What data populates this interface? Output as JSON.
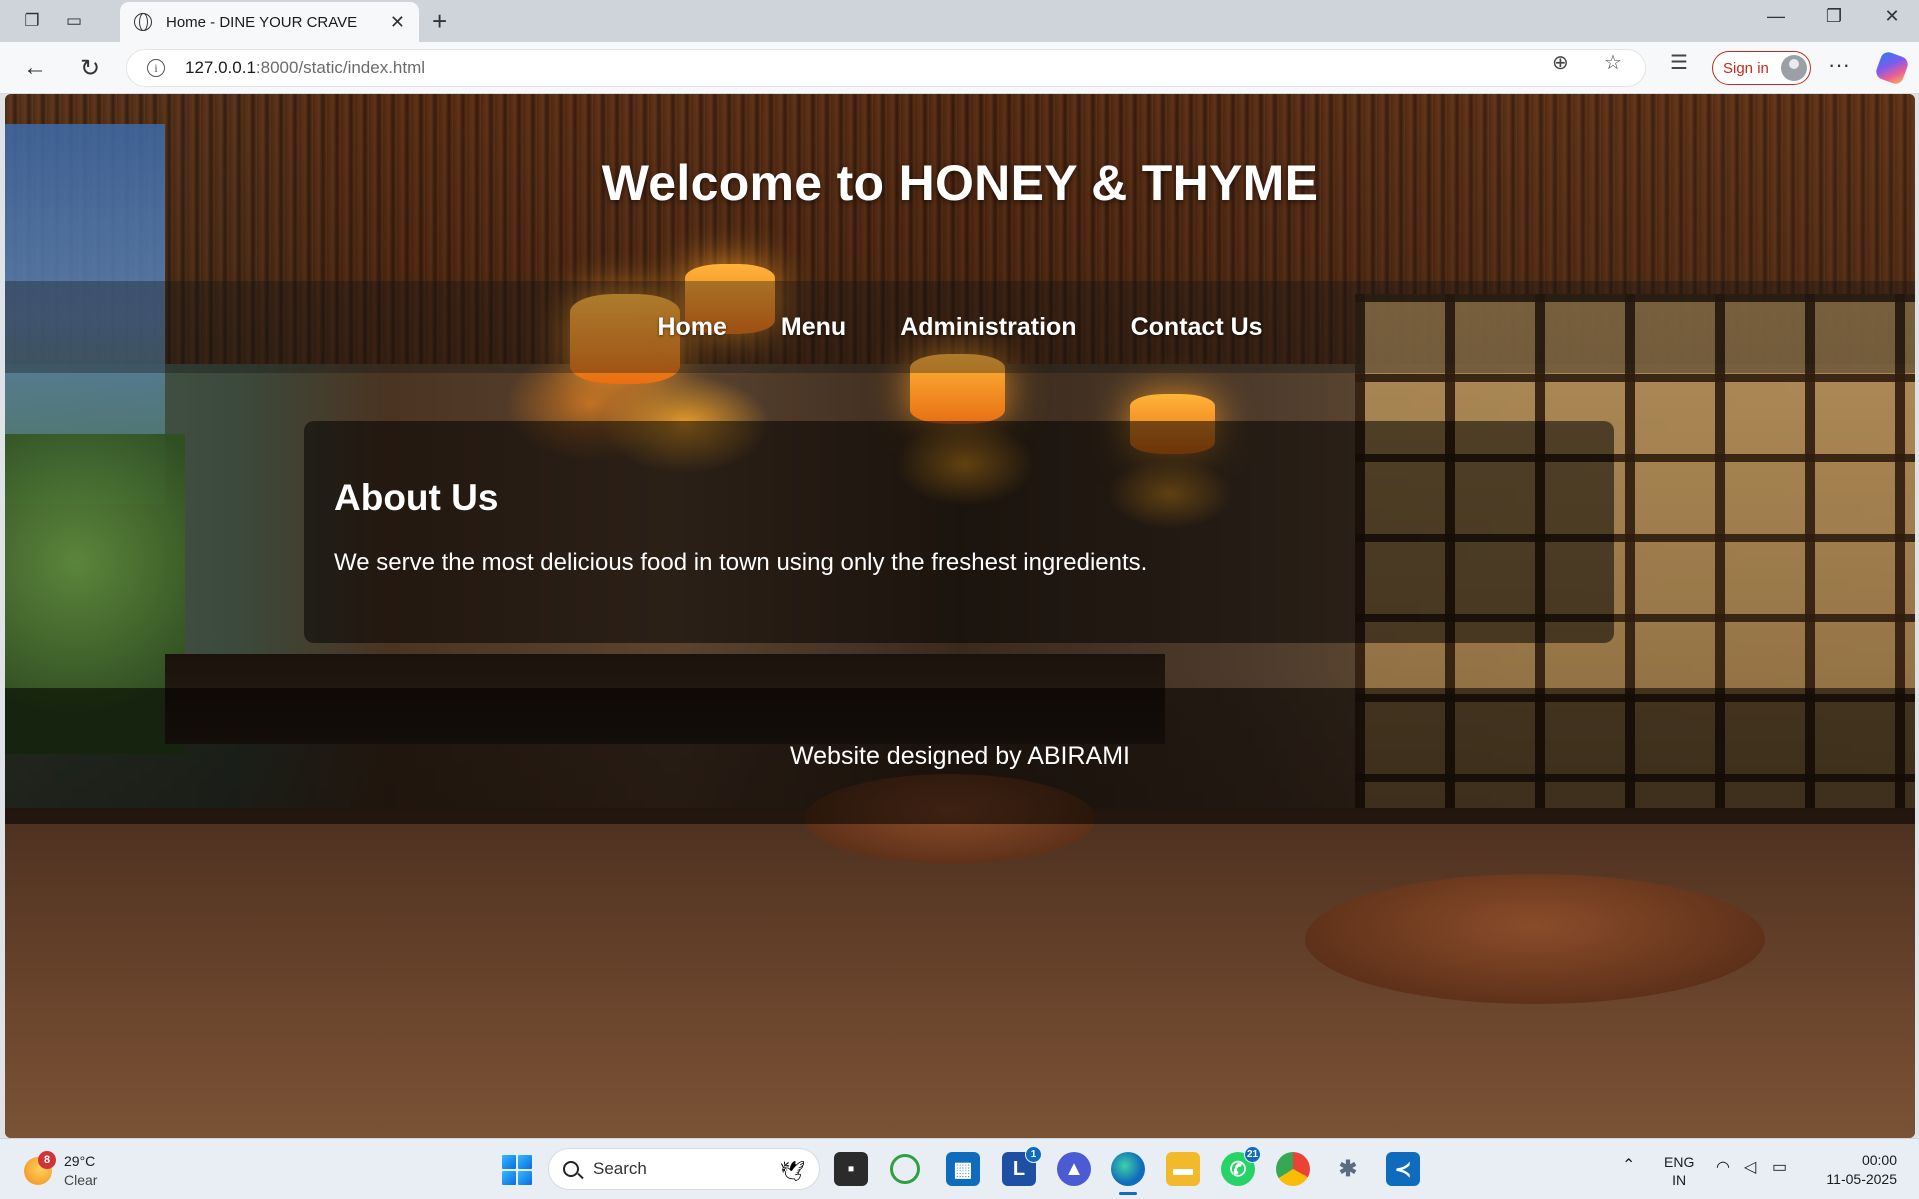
{
  "browser": {
    "tab_title": "Home - DINE YOUR CRAVE",
    "url_host": "127.0.0.1",
    "url_path": ":8000/static/index.html",
    "signin_label": "Sign in"
  },
  "page": {
    "title": "Welcome to HONEY & THYME",
    "nav": [
      "Home",
      "Menu",
      "Administration",
      "Contact Us"
    ],
    "about_heading": "About Us",
    "about_text": "We serve the most delicious food in town using only the freshest ingredients.",
    "footer_text": "Website designed by ABIRAMI"
  },
  "taskbar": {
    "weather_temp": "29°C",
    "weather_condition": "Clear",
    "weather_badge": "8",
    "search_label": "Search",
    "teams_badge": "1",
    "whatsapp_badge": "21",
    "lang_top": "ENG",
    "lang_bottom": "IN",
    "time": "00:00",
    "date": "11-05-2025"
  },
  "colors": {
    "signin_accent": "#c42b1c",
    "taskbar_bg": "#e9eef4",
    "accent_blue": "#0f6cbd"
  }
}
